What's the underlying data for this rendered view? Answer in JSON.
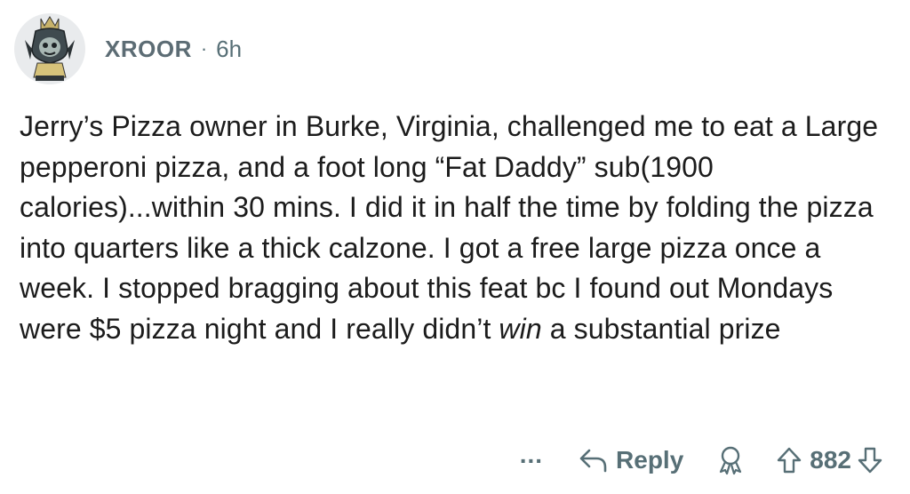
{
  "comment": {
    "username": "XROOR",
    "separator": "·",
    "age": "6h",
    "body_part1": "Jerry’s Pizza owner in Burke, Virginia, challenged me to eat a Large pepperoni pizza, and a foot long “Fat Daddy” sub(1900 calories)...within 30 mins. I did it in half the time by folding the pizza into quarters like a thick calzone. I got a free large pizza once a week. I stopped bragging about this feat bc I found out Mondays were $5 pizza night and I really didn’t ",
    "body_emphasis": "win",
    "body_part2": " a substantial prize"
  },
  "actions": {
    "more_label": "...",
    "reply_label": "Reply",
    "score": "882",
    "reply_icon": "reply-arrow-icon",
    "award_icon": "award-icon",
    "upvote_icon": "upvote-arrow-icon",
    "downvote_icon": "downvote-arrow-icon"
  },
  "colors": {
    "text": "#1c1c1c",
    "meta": "#576f76",
    "avatar_bg": "#e9ebed"
  }
}
